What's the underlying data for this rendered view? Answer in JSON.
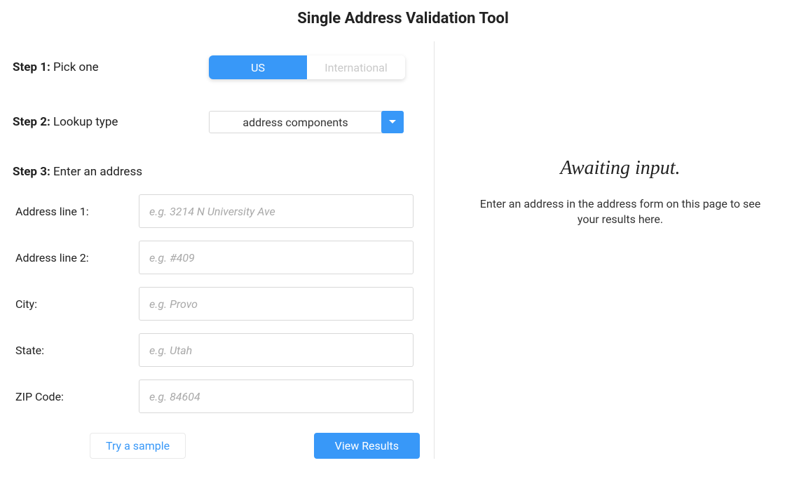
{
  "title": "Single Address Validation Tool",
  "step1": {
    "label_bold": "Step 1:",
    "label_text": " Pick one",
    "option_us": "US",
    "option_intl": "International"
  },
  "step2": {
    "label_bold": "Step 2:",
    "label_text": " Lookup type",
    "selected": "address components"
  },
  "step3": {
    "label_bold": "Step 3:",
    "label_text": " Enter an address"
  },
  "fields": {
    "addr1": {
      "label": "Address line 1:",
      "placeholder": "e.g. 3214 N University Ave"
    },
    "addr2": {
      "label": "Address line 2:",
      "placeholder": "e.g. #409"
    },
    "city": {
      "label": "City:",
      "placeholder": "e.g. Provo"
    },
    "state": {
      "label": "State:",
      "placeholder": "e.g. Utah"
    },
    "zip": {
      "label": "ZIP Code:",
      "placeholder": "e.g. 84604"
    }
  },
  "buttons": {
    "sample": "Try a sample",
    "view": "View Results"
  },
  "results": {
    "heading": "Awaiting input.",
    "sub": "Enter an address in the address form on this page to see your results here."
  }
}
